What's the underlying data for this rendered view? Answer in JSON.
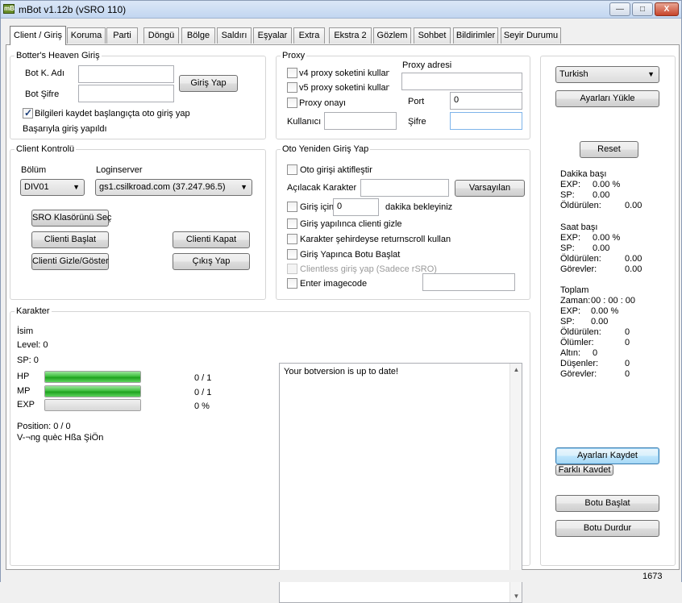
{
  "window": {
    "title": "mBot v1.12b (vSRO 110)",
    "icon": "app-icon",
    "icon_text": "mB",
    "min_glyph": "—",
    "max_glyph": "□",
    "close_glyph": "X"
  },
  "tabs": [
    {
      "label": "Client / Giriş",
      "active": true
    },
    {
      "label": "Koruma"
    },
    {
      "label": "Parti"
    },
    {
      "label": "Döngü"
    },
    {
      "label": "Bölge"
    },
    {
      "label": "Saldırı"
    },
    {
      "label": "Eşyalar"
    },
    {
      "label": "Extra"
    },
    {
      "label": "Ekstra 2"
    },
    {
      "label": "Gözlem"
    },
    {
      "label": "Sohbet"
    },
    {
      "label": "Bildirimler"
    },
    {
      "label": "Seyir Durumu"
    }
  ],
  "login": {
    "group_title": "Botter's Heaven Giriş",
    "username_label": "Bot K. Adı",
    "username_value": "",
    "password_label": "Bot Şifre",
    "password_value": "",
    "login_button": "Giriş Yap",
    "remember_label": "Bilgileri kaydet başlangıçta oto giriş yap",
    "remember_checked": true,
    "status": "Başarıyla giriş yapıldı"
  },
  "proxy": {
    "group_title": "Proxy",
    "v4_label": "v4 proxy soketini kullan",
    "v5_label": "v5 proxy soketini kullan",
    "confirm_label": "Proxy onayı",
    "address_label": "Proxy adresi",
    "address_value": "",
    "port_label": "Port",
    "port_value": "0",
    "user_label": "Kullanıcı",
    "user_value": "",
    "password_label": "Şifre",
    "password_value": ""
  },
  "client_control": {
    "group_title": "Client Kontrolü",
    "division_label": "Bölüm",
    "division_value": "DIV01",
    "loginserver_label": "Loginserver",
    "loginserver_value": "gs1.csilkroad.com (37.247.96.5)",
    "select_folder_button": "SRO Klasörünü Seç",
    "start_client_button": "Clienti Başlat",
    "close_client_button": "Clienti Kapat",
    "hide_show_button": "Clienti Gizle/Göster",
    "exit_button": "Çıkış Yap"
  },
  "auto_relogin": {
    "group_title": "Oto Yeniden Giriş Yap",
    "enable_label": "Oto girişi aktifleştir",
    "character_label": "Açılacak Karakter",
    "character_value": "",
    "default_button": "Varsayılan",
    "wait_prefix": "Giriş için",
    "wait_value": "0",
    "wait_suffix": "dakika bekleyiniz",
    "hide_client_label": "Giriş yapılınca clienti gizle",
    "returnscroll_label": "Karakter şehirdeyse returnscroll kullan",
    "start_bot_label": "Giriş Yapınca Botu Başlat",
    "clientless_label": "Clientless giriş yap (Sadece rSRO)",
    "imagecode_label": "Enter imagecode",
    "imagecode_value": ""
  },
  "character": {
    "group_title": "Karakter",
    "name_label": "İsim",
    "level_text": "Level: 0",
    "sp_text": "SP: 0",
    "hp_label": "HP",
    "hp_value": "0 / 1",
    "hp_fill": 1.0,
    "mp_label": "MP",
    "mp_value": "0 / 1",
    "mp_fill": 1.0,
    "exp_label": "EXP",
    "exp_value": "0 %",
    "exp_fill": 0,
    "position_text": "Position: 0 / 0",
    "location_text": "V-¬ng quèc Hßa ŞiÖn"
  },
  "log": {
    "message": "Your botversion is up to date!"
  },
  "side": {
    "language_value": "Turkish",
    "load_settings_button": "Ayarları Yükle",
    "reset_button": "Reset",
    "per_minute": {
      "title": "Dakika başı",
      "exp_label": "EXP:",
      "exp_value": "0.00 %",
      "sp_label": "SP:",
      "sp_value": "0.00",
      "killed_label": "Öldürülen:",
      "killed_value": "0.00"
    },
    "per_hour": {
      "title": "Saat başı",
      "exp_label": "EXP:",
      "exp_value": "0.00 %",
      "sp_label": "SP:",
      "sp_value": "0.00",
      "killed_label": "Öldürülen:",
      "killed_value": "0.00",
      "quests_label": "Görevler:",
      "quests_value": "0.00"
    },
    "total": {
      "title": "Toplam",
      "time_label": "Zaman:",
      "time_value": "00 : 00 : 00",
      "exp_label": "EXP:",
      "exp_value": "0.00 %",
      "sp_label": "SP:",
      "sp_value": "0.00",
      "killed_label": "Öldürülen:",
      "killed_value": "0",
      "deaths_label": "Ölümler:",
      "deaths_value": "0",
      "gold_label": "Altın:",
      "gold_value": "0",
      "drops_label": "Düşenler:",
      "drops_value": "0",
      "quests_label": "Görevler:",
      "quests_value": "0"
    },
    "save_settings_button": "Ayarları Kaydet",
    "save_as_button": "Farklı Kavdet",
    "start_bot_button": "Botu Başlat",
    "stop_bot_button": "Botu Durdur"
  },
  "status": {
    "counter": "1673"
  }
}
